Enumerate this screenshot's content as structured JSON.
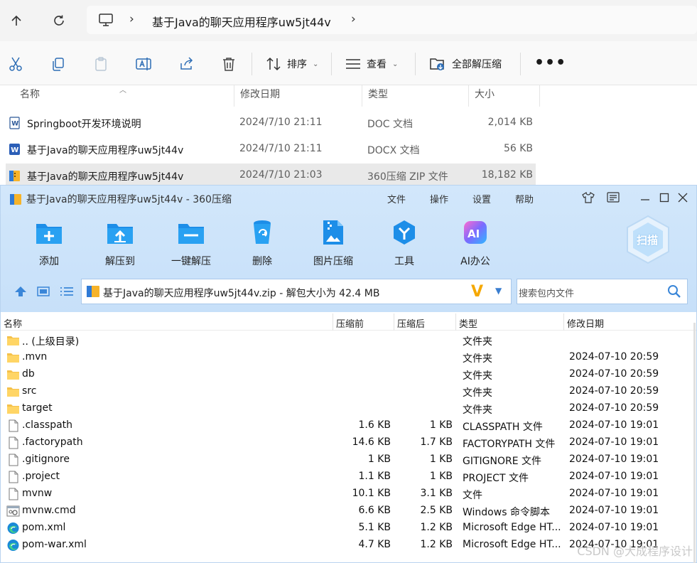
{
  "explorer": {
    "breadcrumb_current": "基于Java的聊天应用程序uw5jt44v",
    "toolbar": {
      "sort_label": "排序",
      "view_label": "查看",
      "extract_all_label": "全部解压缩",
      "more_label": "•••"
    },
    "columns": {
      "name": "名称",
      "date": "修改日期",
      "type": "类型",
      "size": "大小"
    },
    "files": [
      {
        "name": "Springboot开发环境说明",
        "date": "2024/7/10 21:11",
        "type": "DOC 文档",
        "size": "2,014 KB",
        "icon": "word-doc-icon"
      },
      {
        "name": "基于Java的聊天应用程序uw5jt44v",
        "date": "2024/7/10 21:11",
        "type": "DOCX 文档",
        "size": "56 KB",
        "icon": "word-docx-icon"
      },
      {
        "name": "基于Java的聊天应用程序uw5jt44v",
        "date": "2024/7/10 21:03",
        "type": "360压缩 ZIP 文件",
        "size": "18,182 KB",
        "icon": "zip-file-icon",
        "selected": true
      }
    ]
  },
  "zip_window": {
    "title": "基于Java的聊天应用程序uw5jt44v - 360压缩",
    "menu": [
      "文件",
      "操作",
      "设置",
      "帮助"
    ],
    "tools": [
      {
        "label": "添加",
        "icon": "add-icon"
      },
      {
        "label": "解压到",
        "icon": "extract-to-icon"
      },
      {
        "label": "一键解压",
        "icon": "one-click-extract-icon"
      },
      {
        "label": "删除",
        "icon": "delete-icon"
      },
      {
        "label": "图片压缩",
        "icon": "image-compress-icon"
      },
      {
        "label": "工具",
        "icon": "tools-icon"
      },
      {
        "label": "AI办公",
        "icon": "ai-office-icon"
      }
    ],
    "scan_label": "扫描",
    "address": "基于Java的聊天应用程序uw5jt44v.zip - 解包大小为 42.4 MB",
    "search_placeholder": "搜索包内文件",
    "columns": {
      "name": "名称",
      "before": "压缩前",
      "after": "压缩后",
      "type": "类型",
      "date": "修改日期"
    },
    "rows": [
      {
        "name": ".. (上级目录)",
        "before": "",
        "after": "",
        "type": "文件夹",
        "date": "",
        "icon": "folder-icon"
      },
      {
        "name": ".mvn",
        "before": "",
        "after": "",
        "type": "文件夹",
        "date": "2024-07-10 20:59",
        "icon": "folder-icon"
      },
      {
        "name": "db",
        "before": "",
        "after": "",
        "type": "文件夹",
        "date": "2024-07-10 20:59",
        "icon": "folder-icon"
      },
      {
        "name": "src",
        "before": "",
        "after": "",
        "type": "文件夹",
        "date": "2024-07-10 20:59",
        "icon": "folder-icon"
      },
      {
        "name": "target",
        "before": "",
        "after": "",
        "type": "文件夹",
        "date": "2024-07-10 20:59",
        "icon": "folder-icon"
      },
      {
        "name": ".classpath",
        "before": "1.6 KB",
        "after": "1 KB",
        "type": "CLASSPATH 文件",
        "date": "2024-07-10 19:01",
        "icon": "file-icon"
      },
      {
        "name": ".factorypath",
        "before": "14.6 KB",
        "after": "1.7 KB",
        "type": "FACTORYPATH 文件",
        "date": "2024-07-10 19:01",
        "icon": "file-icon"
      },
      {
        "name": ".gitignore",
        "before": "1 KB",
        "after": "1 KB",
        "type": "GITIGNORE 文件",
        "date": "2024-07-10 19:01",
        "icon": "file-icon"
      },
      {
        "name": ".project",
        "before": "1.1 KB",
        "after": "1 KB",
        "type": "PROJECT 文件",
        "date": "2024-07-10 19:01",
        "icon": "file-icon"
      },
      {
        "name": "mvnw",
        "before": "10.1 KB",
        "after": "3.1 KB",
        "type": "文件",
        "date": "2024-07-10 19:01",
        "icon": "file-icon"
      },
      {
        "name": "mvnw.cmd",
        "before": "6.6 KB",
        "after": "2.5 KB",
        "type": "Windows 命令脚本",
        "date": "2024-07-10 19:01",
        "icon": "cmd-script-icon"
      },
      {
        "name": "pom.xml",
        "before": "5.1 KB",
        "after": "1.2 KB",
        "type": "Microsoft Edge HT...",
        "date": "2024-07-10 19:01",
        "icon": "edge-icon"
      },
      {
        "name": "pom-war.xml",
        "before": "4.7 KB",
        "after": "1.2 KB",
        "type": "Microsoft Edge HT...",
        "date": "2024-07-10 19:01",
        "icon": "edge-icon"
      }
    ]
  },
  "watermark": "CSDN @大成程序设计"
}
